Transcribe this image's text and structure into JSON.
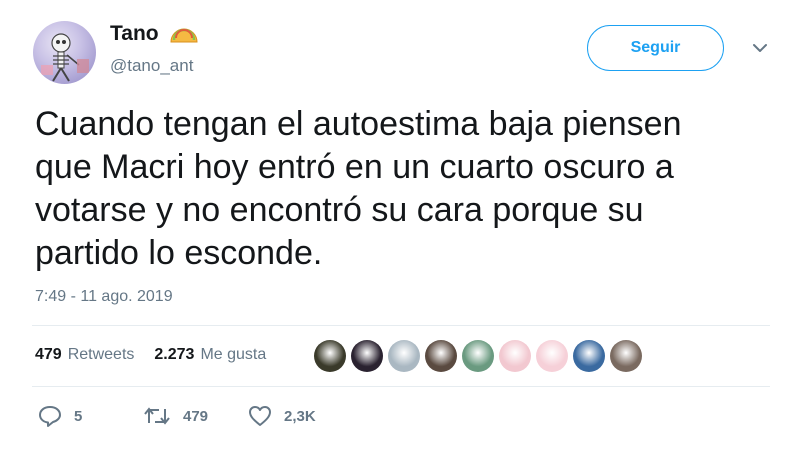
{
  "user": {
    "name": "Tano",
    "handle": "@tano_ant",
    "avatar_icon": "skeleton-avatar",
    "name_emoji": "taco-icon"
  },
  "follow_button": {
    "label": "Seguir"
  },
  "tweet": {
    "lines": [
      "Cuando tengan el autoestima baja piensen",
      "que Macri hoy entró en un cuarto oscuro a",
      "votarse y no encontró su cara porque su",
      "partido lo esconde."
    ],
    "timestamp": "7:49 - 11 ago. 2019"
  },
  "stats": {
    "retweets_count": "479",
    "retweets_label": "Retweets",
    "likes_count": "2.273",
    "likes_label": "Me gusta"
  },
  "likers": [
    {
      "color": "#3a3a2a"
    },
    {
      "color": "#2a2230"
    },
    {
      "color": "#aab8c2"
    },
    {
      "color": "#5a4a40"
    },
    {
      "color": "#6a9a80"
    },
    {
      "color": "#f2c8d0"
    },
    {
      "color": "#f6d0d8"
    },
    {
      "color": "#3a6aa0"
    },
    {
      "color": "#7a6a60"
    }
  ],
  "actions": {
    "replies": "5",
    "retweets": "479",
    "likes": "2,3K"
  },
  "colors": {
    "accent": "#1da1f2",
    "muted": "#657786",
    "text": "#14171a",
    "divider": "#e6ecf0"
  }
}
